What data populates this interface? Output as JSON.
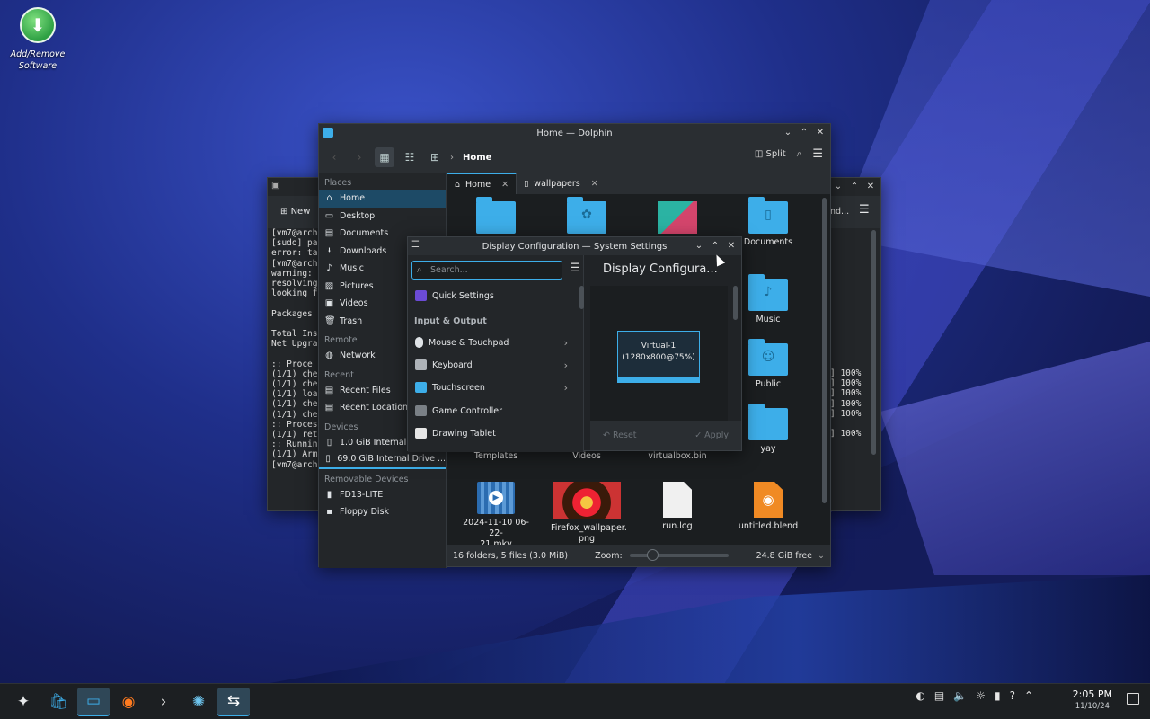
{
  "desktop": {
    "icon_label_line1": "Add/Remove",
    "icon_label_line2": "Software"
  },
  "terminal": {
    "toolbar_new": "New",
    "toolbar_right": "nd...",
    "lines_left": [
      "[vm7@arch",
      "[sudo] pa",
      "error: ta",
      "[vm7@arch",
      "warning: ",
      "resolving",
      "looking f",
      "",
      "Packages ",
      "",
      "Total Ins",
      "Net Upgra",
      "",
      ":: Proce",
      "(1/1) che",
      "(1/1) che",
      "(1/1) loa",
      "(1/1) che",
      "(1/1) che",
      ":: Proces",
      "(1/1) ret",
      ":: Runnin",
      "(1/1) Arm",
      "[vm7@arch"
    ],
    "lines_right": [
      "] 100%",
      "] 100%",
      "] 100%",
      "] 100%",
      "] 100%",
      "",
      "] 100%"
    ]
  },
  "dolphin": {
    "title": "Home — Dolphin",
    "breadcrumb": "Home",
    "split_label": "Split",
    "places_header": "Places",
    "places": [
      "Home",
      "Desktop",
      "Documents",
      "Downloads",
      "Music",
      "Pictures",
      "Videos",
      "Trash"
    ],
    "remote_header": "Remote",
    "remote": [
      "Network"
    ],
    "recent_header": "Recent",
    "recent": [
      "Recent Files",
      "Recent Locations"
    ],
    "devices_header": "Devices",
    "devices": [
      "1.0 GiB Internal Drive (",
      "69.0 GiB Internal Drive ..."
    ],
    "removable_header": "Removable Devices",
    "removable": [
      "FD13-LITE",
      "Floppy Disk"
    ],
    "tabs": [
      "Home",
      "wallpapers"
    ],
    "files": {
      "documents": "Documents",
      "music": "Music",
      "public": "Public",
      "templates": "Templates",
      "videos": "Videos",
      "virtualbox": "virtualbox.bin",
      "yay": "yay",
      "mkv_line1": "2024-11-10 06-22-",
      "mkv_line2": "21.mkv",
      "firefox_line1": "Firefox_wallpaper.",
      "firefox_line2": "png",
      "runlog": "run.log",
      "blend": "untitled.blend"
    },
    "status": "16 folders, 5 files (3.0 MiB)",
    "zoom_label": "Zoom:",
    "zoom_level": 0.25,
    "free_space": "24.8 GiB free"
  },
  "settings": {
    "title": "Display Configuration — System Settings",
    "search_placeholder": "Search...",
    "quick_settings": "Quick Settings",
    "section_header": "Input & Output",
    "items": [
      "Mouse & Touchpad",
      "Keyboard",
      "Touchscreen",
      "Game Controller",
      "Drawing Tablet"
    ],
    "page_title": "Display Configura...",
    "screen_name": "Virtual-1",
    "screen_mode": "(1280x800@75%)",
    "reset_label": "Reset",
    "apply_label": "Apply"
  },
  "taskbar": {
    "clock_time": "2:05 PM",
    "clock_date": "11/10/24"
  },
  "colors": {
    "accent": "#3daee9",
    "window_bg": "#202326",
    "taskbar_bg": "#1c1f22"
  }
}
